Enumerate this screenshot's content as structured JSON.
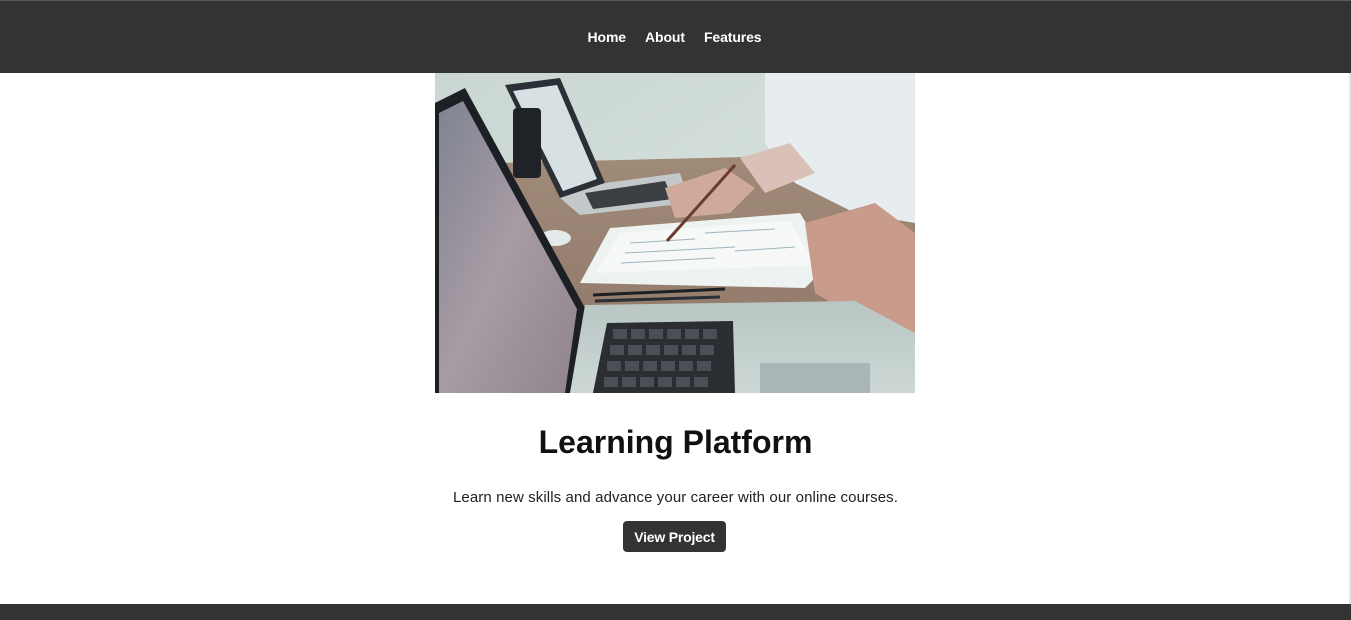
{
  "nav": {
    "items": [
      {
        "label": "Home"
      },
      {
        "label": "About"
      },
      {
        "label": "Features"
      }
    ]
  },
  "hero": {
    "image_subject": "laptops-and-documents-on-desk-photo",
    "title": "Learning Platform",
    "description": "Learn new skills and advance your career with our online courses.",
    "button_label": "View Project"
  },
  "colors": {
    "nav_background": "#333333",
    "nav_text": "#ffffff",
    "button_background": "#333333",
    "button_text": "#ffffff",
    "page_background": "#ffffff",
    "footer_background": "#333333"
  }
}
